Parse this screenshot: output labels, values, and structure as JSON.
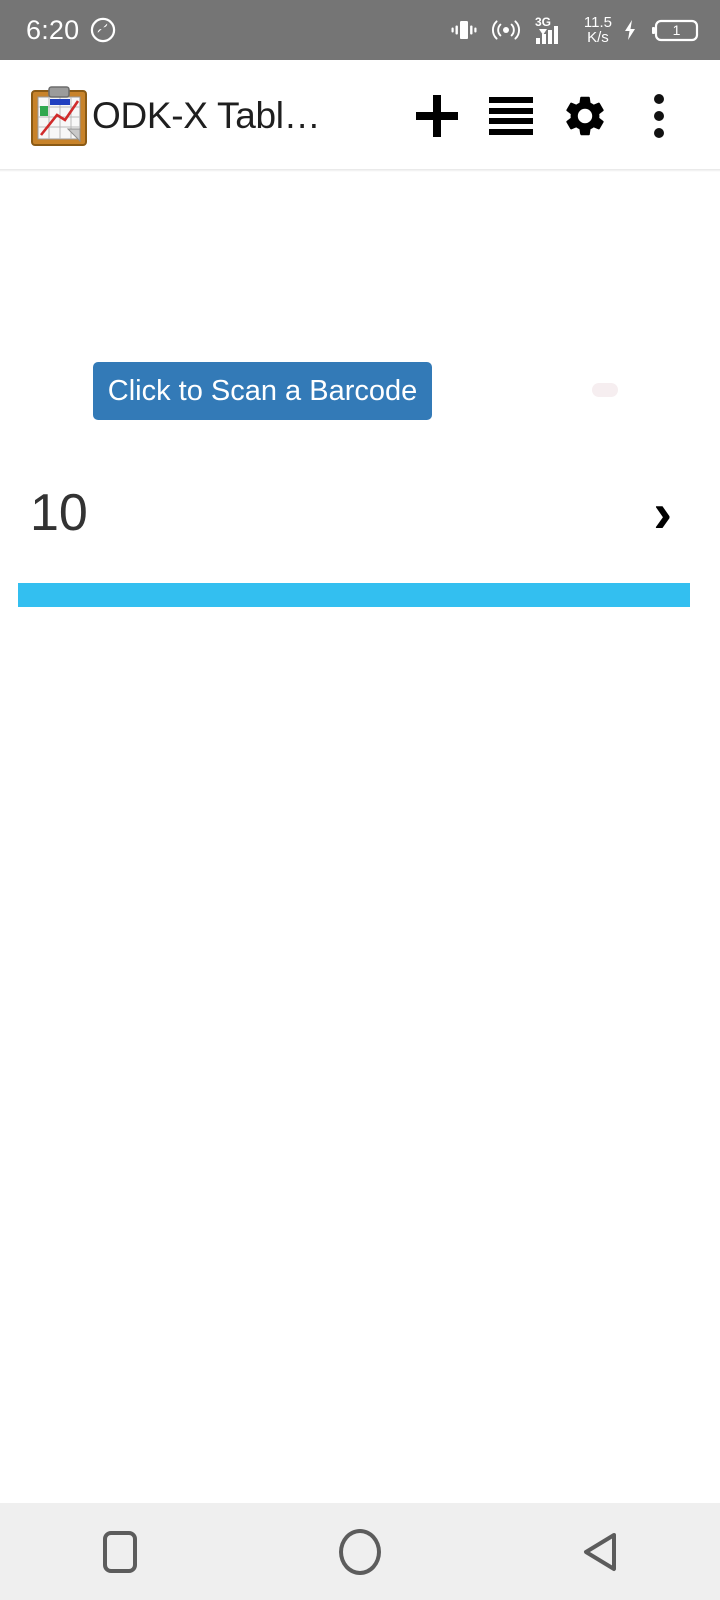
{
  "status_bar": {
    "time": "6:20",
    "mode_icon": "silent-mode-icon",
    "icons": {
      "vibrate": "vibrate-icon",
      "hotspot": "hotspot-icon",
      "signal": "signal-3g-icon",
      "charging": "charging-bolt-icon",
      "battery": "battery-icon"
    },
    "network_type": "3G",
    "network_speed_value": "11.5",
    "network_speed_unit": "K/s",
    "battery_level": "1",
    "background_color": "#757575"
  },
  "app_bar": {
    "icon_name": "clipboard-chart-icon",
    "title": "ODK-X Tabl…",
    "actions": [
      {
        "name": "add-button",
        "icon": "plus-icon"
      },
      {
        "name": "menu-button",
        "icon": "hamburger-icon"
      },
      {
        "name": "settings-button",
        "icon": "gear-icon"
      },
      {
        "name": "overflow-button",
        "icon": "more-vertical-icon"
      }
    ]
  },
  "content": {
    "scan_button_label": "Click to Scan a Barcode",
    "scan_button_color": "#337ab7",
    "ghost_pill_color": "#f6eef0",
    "row_value": "10",
    "row_chevron": "›",
    "progress_bar_color": "#33bff0"
  },
  "nav_bar": {
    "background_color": "#efefef",
    "buttons": [
      {
        "name": "recents-button",
        "icon": "square-icon"
      },
      {
        "name": "home-button",
        "icon": "circle-icon"
      },
      {
        "name": "back-button",
        "icon": "triangle-left-icon"
      }
    ]
  }
}
